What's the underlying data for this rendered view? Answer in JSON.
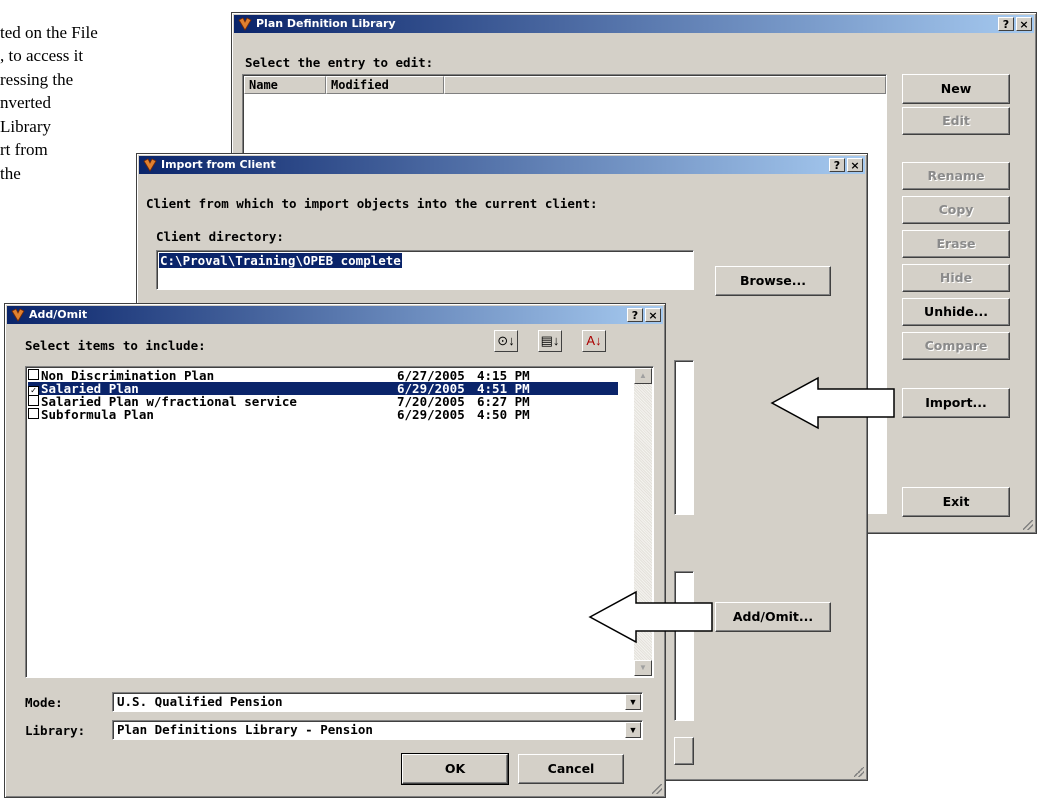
{
  "background_text": [
    "ted on the File",
    ", to access it",
    "ressing the",
    "nverted",
    "Library",
    "rt from",
    "the"
  ],
  "plan_def": {
    "title": "Plan Definition Library",
    "select_label": "Select the entry to edit:",
    "columns": [
      "Name",
      "Modified"
    ],
    "buttons": {
      "new": "New",
      "edit": "Edit",
      "rename": "Rename",
      "copy": "Copy",
      "erase": "Erase",
      "hide": "Hide",
      "unhide": "Unhide...",
      "compare": "Compare",
      "import": "Import...",
      "exit": "Exit"
    }
  },
  "import_client": {
    "title": "Import from Client",
    "heading": "Client from which to import objects into the current client:",
    "dir_label": "Client directory:",
    "dir_value": "C:\\Proval\\Training\\OPEB complete",
    "browse": "Browse...",
    "add_omit": "Add/Omit..."
  },
  "add_omit": {
    "title": "Add/Omit",
    "select_label": "Select items to include:",
    "items": [
      {
        "name": "Non Discrimination Plan",
        "date": "6/27/2005",
        "time": "4:15 PM",
        "checked": false,
        "selected": false
      },
      {
        "name": "Salaried Plan",
        "date": "6/29/2005",
        "time": "4:51 PM",
        "checked": true,
        "selected": true
      },
      {
        "name": "Salaried Plan w/fractional service",
        "date": "7/20/2005",
        "time": "6:27 PM",
        "checked": false,
        "selected": false
      },
      {
        "name": "Subformula Plan",
        "date": "6/29/2005",
        "time": "4:50 PM",
        "checked": false,
        "selected": false
      }
    ],
    "mode_label": "Mode:",
    "mode_value": "U.S. Qualified Pension",
    "library_label": "Library:",
    "library_value": "Plan Definitions Library - Pension",
    "ok": "OK",
    "cancel": "Cancel"
  },
  "title_buttons": {
    "help": "?",
    "close": "×"
  },
  "colors": {
    "titlebar": "#0a246a",
    "dialog": "#d4d0c8",
    "selection": "#0a246a"
  }
}
